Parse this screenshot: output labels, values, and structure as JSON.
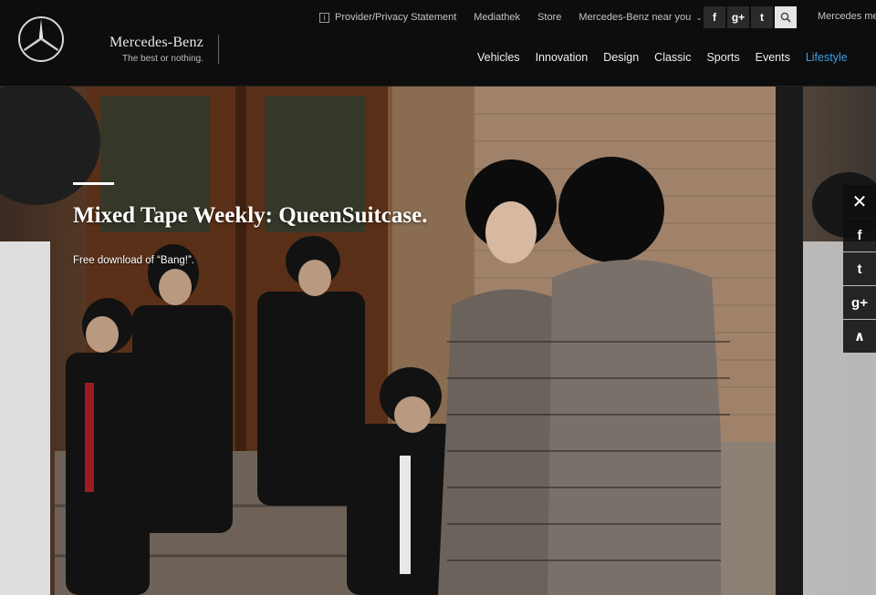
{
  "brand": {
    "name": "Mercedes-Benz",
    "tagline": "The best or nothing."
  },
  "top_links": {
    "provider": "Provider/Privacy Statement",
    "mediathek": "Mediathek",
    "store": "Store",
    "near_you": "Mercedes-Benz near you",
    "me": "Mercedes me"
  },
  "social": {
    "facebook": "f",
    "google_plus": "g+",
    "twitter": "t"
  },
  "nav": {
    "items": [
      "Vehicles",
      "Innovation",
      "Design",
      "Classic",
      "Sports",
      "Events",
      "Lifestyle"
    ],
    "active": "Lifestyle"
  },
  "hero": {
    "title": "Mixed Tape Weekly: QueenSuitcase.",
    "subtitle": "Free download of “Bang!”."
  },
  "share_rail": {
    "close": "✕",
    "facebook": "f",
    "twitter": "t",
    "google_plus": "g+",
    "up": "∧"
  },
  "colors": {
    "header_bg": "#0d0d0d",
    "accent": "#3ba0e6"
  }
}
